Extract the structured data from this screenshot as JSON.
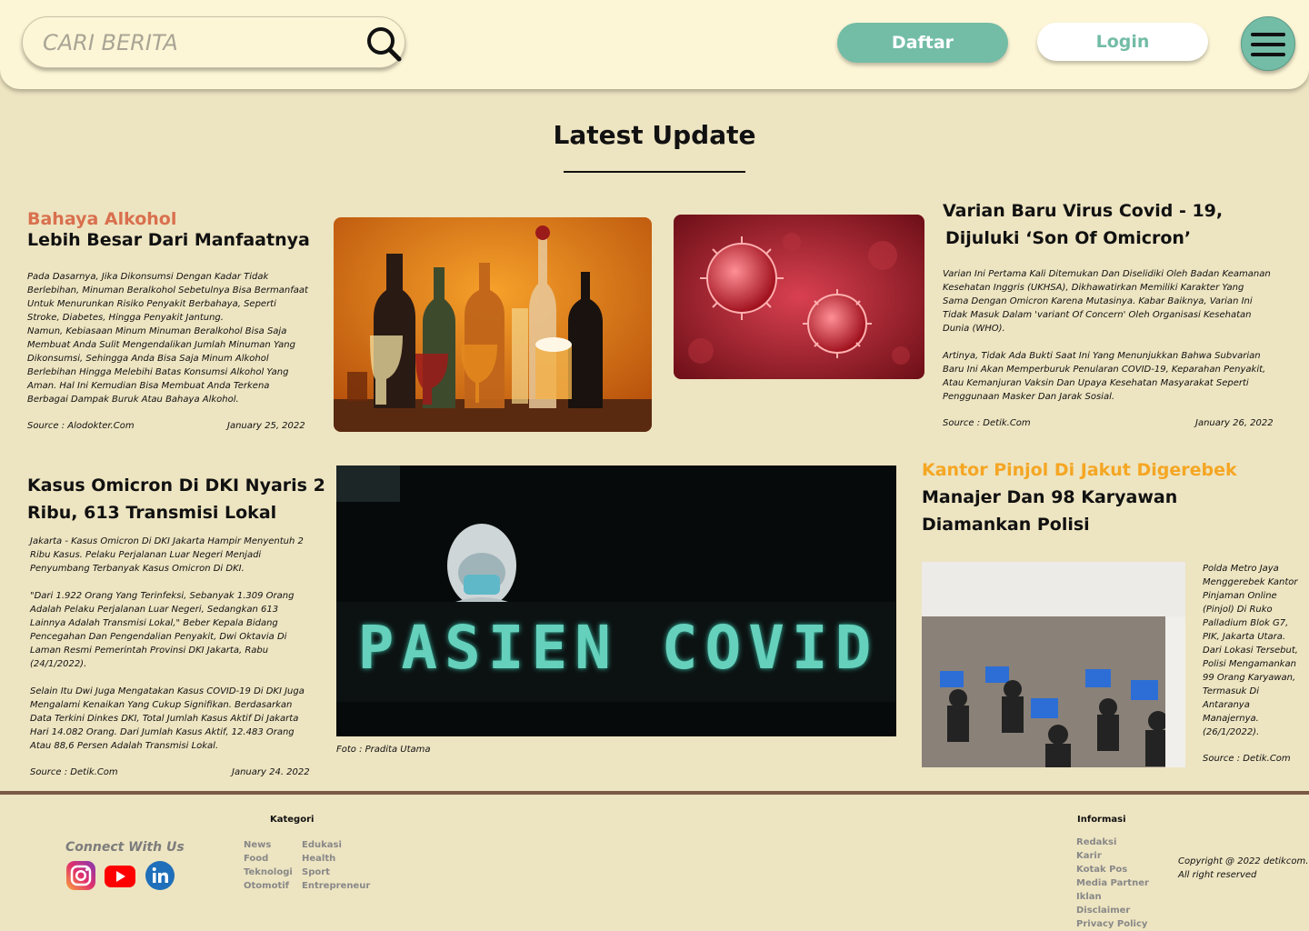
{
  "header": {
    "search_placeholder": "CARI BERITA",
    "daftar_label": "Daftar",
    "login_label": "Login"
  },
  "section": {
    "title": "Latest Update"
  },
  "articles": {
    "alkohol": {
      "title_highlight": "Bahaya Alkohol",
      "title_rest": "Lebih Besar Dari Manfaatnya",
      "body": "Pada Dasarnya, Jika Dikonsumsi Dengan Kadar Tidak Berlebihan, Minuman Beralkohol Sebetulnya Bisa Bermanfaat Untuk Menurunkan Risiko Penyakit Berbahaya, Seperti Stroke, Diabetes, Hingga Penyakit Jantung.\nNamun, Kebiasaan Minum Minuman Beralkohol Bisa Saja Membuat Anda Sulit Mengendalikan Jumlah Minuman Yang Dikonsumsi, Sehingga Anda Bisa Saja Minum Alkohol Berlebihan Hingga Melebihi Batas Konsumsi Alkohol Yang Aman. Hal Ini Kemudian Bisa Membuat Anda Terkena Berbagai Dampak Buruk Atau Bahaya Alkohol.",
      "source": "Source : Alodokter.Com",
      "date": "January 25, 2022",
      "highlight_color": "#d9704e"
    },
    "omicron_variant": {
      "title_line1": "Varian Baru Virus Covid - 19,",
      "title_line2": "Dijuluki ‘Son Of Omicron’",
      "body1": "Varian Ini Pertama Kali Ditemukan Dan Diselidiki Oleh Badan Keamanan Kesehatan Inggris (UKHSA), Dikhawatirkan Memiliki Karakter Yang Sama Dengan Omicron Karena Mutasinya. Kabar Baiknya, Varian Ini Tidak Masuk Dalam 'variant Of Concern' Oleh Organisasi Kesehatan Dunia (WHO).",
      "body2": "Artinya, Tidak Ada Bukti Saat Ini Yang Menunjukkan Bahwa Subvarian Baru Ini Akan Memperburuk Penularan COVID-19, Keparahan Penyakit, Atau Kemanjuran Vaksin Dan Upaya Kesehatan Masyarakat Seperti Penggunaan Masker Dan Jarak Sosial.",
      "source": "Source : Detik.Com",
      "date": "January 26, 2022"
    },
    "kasus_omicron": {
      "title_line1": "Kasus Omicron Di DKI Nyaris 2",
      "title_line2": "Ribu, 613 Transmisi Lokal",
      "body1": "Jakarta -  Kasus Omicron Di DKI Jakarta Hampir Menyentuh 2 Ribu Kasus. Pelaku Perjalanan Luar Negeri Menjadi Penyumbang Terbanyak Kasus Omicron Di DKI.",
      "body2": "\"Dari 1.922 Orang Yang Terinfeksi, Sebanyak 1.309 Orang Adalah Pelaku Perjalanan Luar Negeri, Sedangkan 613 Lainnya Adalah Transmisi Lokal,\" Beber Kepala Bidang Pencegahan Dan Pengendalian Penyakit, Dwi Oktavia Di Laman Resmi Pemerintah Provinsi DKI Jakarta, Rabu (24/1/2022).",
      "body3": "Selain Itu Dwi Juga Mengatakan Kasus COVID-19 Di DKI Juga Mengalami Kenaikan Yang Cukup Signifikan. Berdasarkan Data Terkini Dinkes DKI, Total Jumlah Kasus Aktif Di Jakarta Hari 14.082 Orang. Dari Jumlah Kasus Aktif, 12.483 Orang Atau 88,6 Persen Adalah Transmisi Lokal.",
      "source": "Source : Detik.Com",
      "date": "January 24. 2022",
      "photo_caption": "Foto : Pradita Utama",
      "sign_text": "PASIEN COVID"
    },
    "pinjol": {
      "title_highlight": "Kantor Pinjol Di Jakut Digerebek",
      "title_line2": "Manajer Dan 98 Karyawan",
      "title_line3": "Diamankan Polisi",
      "body": "Polda Metro Jaya Menggerebek Kantor Pinjaman Online (Pinjol) Di Ruko Palladium Blok G7, PIK, Jakarta Utara. Dari Lokasi Tersebut, Polisi Mengamankan 99 Orang Karyawan, Termasuk Di Antaranya Manajernya.\n (26/1/2022).",
      "source": "Source : Detik.Com",
      "highlight_color": "#f5a623"
    }
  },
  "footer": {
    "connect_label": "Connect With Us",
    "social_icons": [
      "instagram-icon",
      "youtube-icon",
      "linkedin-icon"
    ],
    "kategori_title": "Kategori",
    "kategori_col1": [
      "News",
      "Food",
      "Teknologi",
      "Otomotif"
    ],
    "kategori_col2": [
      "Edukasi",
      "Health",
      "Sport",
      "Entrepreneur"
    ],
    "informasi_title": "Informasi",
    "informasi_links": [
      "Redaksi",
      "Karir",
      "Kotak Pos",
      "Media Partner",
      "Iklan",
      "Disclaimer",
      "Privacy Policy"
    ],
    "copyright": "Copyright @ 2022 detikcom. All right reserved"
  },
  "colors": {
    "background": "#ede4c1",
    "header": "#fdf6d6",
    "accent": "#73bca6",
    "footer_border": "#7a5a45"
  }
}
